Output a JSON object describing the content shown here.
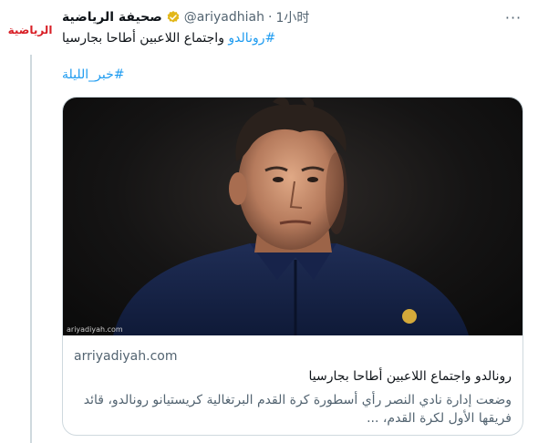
{
  "account": {
    "name": "صحيفة الرياضية",
    "handle": "@ariyadhiah",
    "separator": "·",
    "time": "1小时",
    "avatar_text": "الرياضية",
    "more_label": "···"
  },
  "tweet": {
    "hashtag1": "#رونالدو",
    "text1": " واجتماع اللاعبين أطاحا بجارسيا",
    "hashtag2": "#خبر_الليلة"
  },
  "card": {
    "image_alt": "Rudi Garcia",
    "watermark": "ariyadiyah.com",
    "domain": "arriyadiyah.com",
    "title": "رونالدو واجتماع اللاعبين أطاحا بجارسيا",
    "description": "وضعت إدارة نادي النصر رأي أسطورة كرة القدم البرتغالية كريستيانو رونالدو، قائد فريقها الأول لكرة القدم، ..."
  },
  "colors": {
    "link": "#1d9bf0",
    "verified": "#e2b719",
    "secondary": "#536471"
  }
}
